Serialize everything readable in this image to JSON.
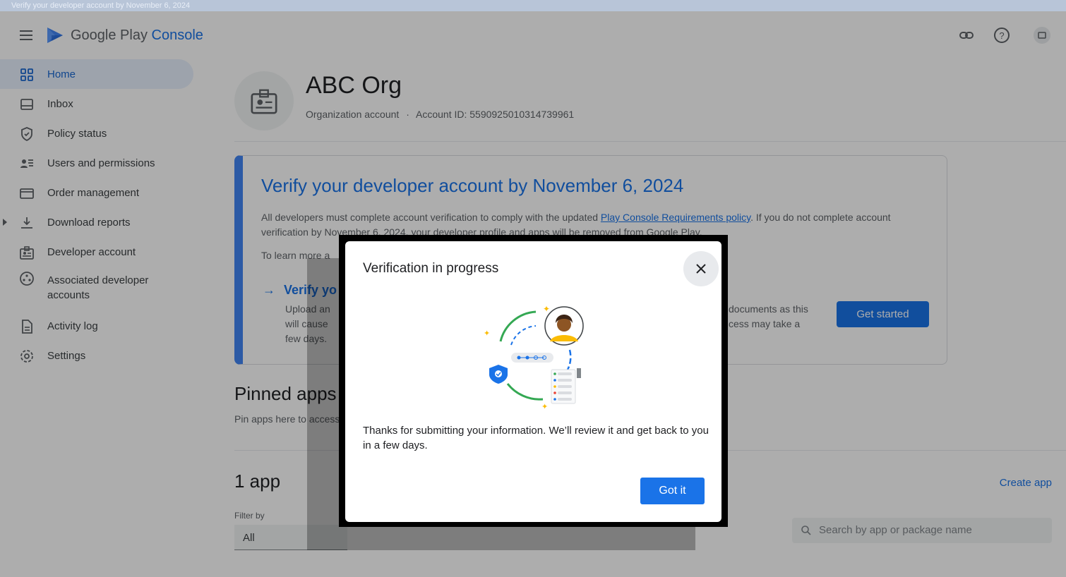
{
  "top_banner": "Verify your developer account by November 6, 2024",
  "header": {
    "brand_main": "Google Play",
    "brand_accent": "Console",
    "icons": [
      "menu-icon",
      "link-icon",
      "help-icon",
      "notifications-icon"
    ]
  },
  "sidebar": {
    "items": [
      {
        "label": "Home",
        "icon": "home-icon",
        "active": true
      },
      {
        "label": "Inbox",
        "icon": "inbox-icon"
      },
      {
        "label": "Policy status",
        "icon": "shield-icon"
      },
      {
        "label": "Users and permissions",
        "icon": "users-icon"
      },
      {
        "label": "Order management",
        "icon": "credit-card-icon"
      },
      {
        "label": "Download reports",
        "icon": "download-icon",
        "expandable": true
      },
      {
        "label": "Developer account",
        "icon": "id-badge-icon"
      },
      {
        "label": "Associated developer accounts",
        "icon": "associated-accounts-icon"
      },
      {
        "label": "Activity log",
        "icon": "document-icon"
      },
      {
        "label": "Settings",
        "icon": "gear-icon"
      }
    ]
  },
  "org": {
    "name": "ABC Org",
    "type": "Organization account",
    "separator": "·",
    "account_id": "Account ID: 5590925010314739961"
  },
  "verify_card": {
    "title": "Verify your developer account by November 6, 2024",
    "body_pre": "All developers must complete account verification to comply with the updated ",
    "body_link": "Play Console Requirements policy",
    "body_post": ". If you do not complete account verification by November 6, 2024, your developer profile and apps will be removed from Google Play.",
    "learn_more": "To learn more a",
    "step_title": "Verify yo",
    "step_body": "Upload an\nwill cause\nfew days.",
    "step_body_right": "documents as this\ncess may take a",
    "cta": "Get started"
  },
  "pinned": {
    "title": "Pinned apps",
    "subtitle": "Pin apps here to access"
  },
  "apps": {
    "count_label": "1 app",
    "create_label": "Create app",
    "filter_label": "Filter by",
    "filter_value": "All",
    "search_placeholder": "Search by app or package name"
  },
  "dialog": {
    "title": "Verification in progress",
    "message": "Thanks for submitting your information. We’ll review it and get back to you in a few days.",
    "confirm": "Got it",
    "illustration": "verification-illustration",
    "close_icon": "close-icon"
  },
  "colors": {
    "accent": "#1a73e8",
    "active_nav_bg": "#e8f0fe",
    "scrim": "rgba(0,0,0,0.32)"
  }
}
